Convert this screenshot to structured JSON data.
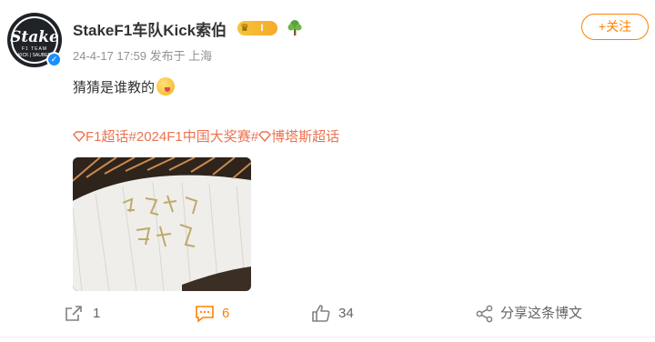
{
  "user": {
    "name": "StakeF1车队Kick索伯",
    "avatar_text": "Stake",
    "avatar_sub": "F1 TEAM",
    "avatar_sub2": "KICK | SAUBER",
    "badge_level": "I",
    "verified_icon": "verified-check-icon"
  },
  "post": {
    "meta": "24-4-17 17:59  发布于 上海",
    "text": "猜猜是谁教的",
    "tags": [
      "F1超话",
      "#2024F1中国大奖赛#",
      "博塔斯超话"
    ],
    "image_alt": "folding hand fan with gold calligraphy"
  },
  "follow_button": {
    "label": "+关注"
  },
  "actions": {
    "repost_count": "1",
    "comment_count": "6",
    "like_count": "34",
    "share_label": "分享这条博文"
  },
  "colors": {
    "accent_orange": "#ff8200",
    "tag_color": "#eb7350",
    "meta_gray": "#939393"
  }
}
